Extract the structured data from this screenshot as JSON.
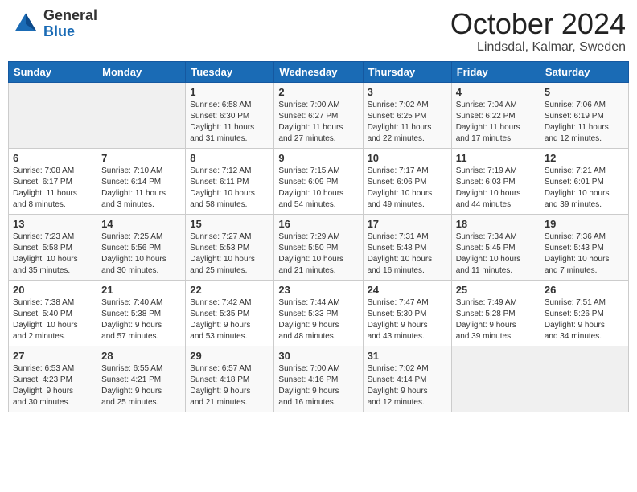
{
  "header": {
    "logo_general": "General",
    "logo_blue": "Blue",
    "month": "October 2024",
    "location": "Lindsdal, Kalmar, Sweden"
  },
  "days_of_week": [
    "Sunday",
    "Monday",
    "Tuesday",
    "Wednesday",
    "Thursday",
    "Friday",
    "Saturday"
  ],
  "weeks": [
    [
      {
        "day": "",
        "info": ""
      },
      {
        "day": "",
        "info": ""
      },
      {
        "day": "1",
        "info": "Sunrise: 6:58 AM\nSunset: 6:30 PM\nDaylight: 11 hours\nand 31 minutes."
      },
      {
        "day": "2",
        "info": "Sunrise: 7:00 AM\nSunset: 6:27 PM\nDaylight: 11 hours\nand 27 minutes."
      },
      {
        "day": "3",
        "info": "Sunrise: 7:02 AM\nSunset: 6:25 PM\nDaylight: 11 hours\nand 22 minutes."
      },
      {
        "day": "4",
        "info": "Sunrise: 7:04 AM\nSunset: 6:22 PM\nDaylight: 11 hours\nand 17 minutes."
      },
      {
        "day": "5",
        "info": "Sunrise: 7:06 AM\nSunset: 6:19 PM\nDaylight: 11 hours\nand 12 minutes."
      }
    ],
    [
      {
        "day": "6",
        "info": "Sunrise: 7:08 AM\nSunset: 6:17 PM\nDaylight: 11 hours\nand 8 minutes."
      },
      {
        "day": "7",
        "info": "Sunrise: 7:10 AM\nSunset: 6:14 PM\nDaylight: 11 hours\nand 3 minutes."
      },
      {
        "day": "8",
        "info": "Sunrise: 7:12 AM\nSunset: 6:11 PM\nDaylight: 10 hours\nand 58 minutes."
      },
      {
        "day": "9",
        "info": "Sunrise: 7:15 AM\nSunset: 6:09 PM\nDaylight: 10 hours\nand 54 minutes."
      },
      {
        "day": "10",
        "info": "Sunrise: 7:17 AM\nSunset: 6:06 PM\nDaylight: 10 hours\nand 49 minutes."
      },
      {
        "day": "11",
        "info": "Sunrise: 7:19 AM\nSunset: 6:03 PM\nDaylight: 10 hours\nand 44 minutes."
      },
      {
        "day": "12",
        "info": "Sunrise: 7:21 AM\nSunset: 6:01 PM\nDaylight: 10 hours\nand 39 minutes."
      }
    ],
    [
      {
        "day": "13",
        "info": "Sunrise: 7:23 AM\nSunset: 5:58 PM\nDaylight: 10 hours\nand 35 minutes."
      },
      {
        "day": "14",
        "info": "Sunrise: 7:25 AM\nSunset: 5:56 PM\nDaylight: 10 hours\nand 30 minutes."
      },
      {
        "day": "15",
        "info": "Sunrise: 7:27 AM\nSunset: 5:53 PM\nDaylight: 10 hours\nand 25 minutes."
      },
      {
        "day": "16",
        "info": "Sunrise: 7:29 AM\nSunset: 5:50 PM\nDaylight: 10 hours\nand 21 minutes."
      },
      {
        "day": "17",
        "info": "Sunrise: 7:31 AM\nSunset: 5:48 PM\nDaylight: 10 hours\nand 16 minutes."
      },
      {
        "day": "18",
        "info": "Sunrise: 7:34 AM\nSunset: 5:45 PM\nDaylight: 10 hours\nand 11 minutes."
      },
      {
        "day": "19",
        "info": "Sunrise: 7:36 AM\nSunset: 5:43 PM\nDaylight: 10 hours\nand 7 minutes."
      }
    ],
    [
      {
        "day": "20",
        "info": "Sunrise: 7:38 AM\nSunset: 5:40 PM\nDaylight: 10 hours\nand 2 minutes."
      },
      {
        "day": "21",
        "info": "Sunrise: 7:40 AM\nSunset: 5:38 PM\nDaylight: 9 hours\nand 57 minutes."
      },
      {
        "day": "22",
        "info": "Sunrise: 7:42 AM\nSunset: 5:35 PM\nDaylight: 9 hours\nand 53 minutes."
      },
      {
        "day": "23",
        "info": "Sunrise: 7:44 AM\nSunset: 5:33 PM\nDaylight: 9 hours\nand 48 minutes."
      },
      {
        "day": "24",
        "info": "Sunrise: 7:47 AM\nSunset: 5:30 PM\nDaylight: 9 hours\nand 43 minutes."
      },
      {
        "day": "25",
        "info": "Sunrise: 7:49 AM\nSunset: 5:28 PM\nDaylight: 9 hours\nand 39 minutes."
      },
      {
        "day": "26",
        "info": "Sunrise: 7:51 AM\nSunset: 5:26 PM\nDaylight: 9 hours\nand 34 minutes."
      }
    ],
    [
      {
        "day": "27",
        "info": "Sunrise: 6:53 AM\nSunset: 4:23 PM\nDaylight: 9 hours\nand 30 minutes."
      },
      {
        "day": "28",
        "info": "Sunrise: 6:55 AM\nSunset: 4:21 PM\nDaylight: 9 hours\nand 25 minutes."
      },
      {
        "day": "29",
        "info": "Sunrise: 6:57 AM\nSunset: 4:18 PM\nDaylight: 9 hours\nand 21 minutes."
      },
      {
        "day": "30",
        "info": "Sunrise: 7:00 AM\nSunset: 4:16 PM\nDaylight: 9 hours\nand 16 minutes."
      },
      {
        "day": "31",
        "info": "Sunrise: 7:02 AM\nSunset: 4:14 PM\nDaylight: 9 hours\nand 12 minutes."
      },
      {
        "day": "",
        "info": ""
      },
      {
        "day": "",
        "info": ""
      }
    ]
  ]
}
